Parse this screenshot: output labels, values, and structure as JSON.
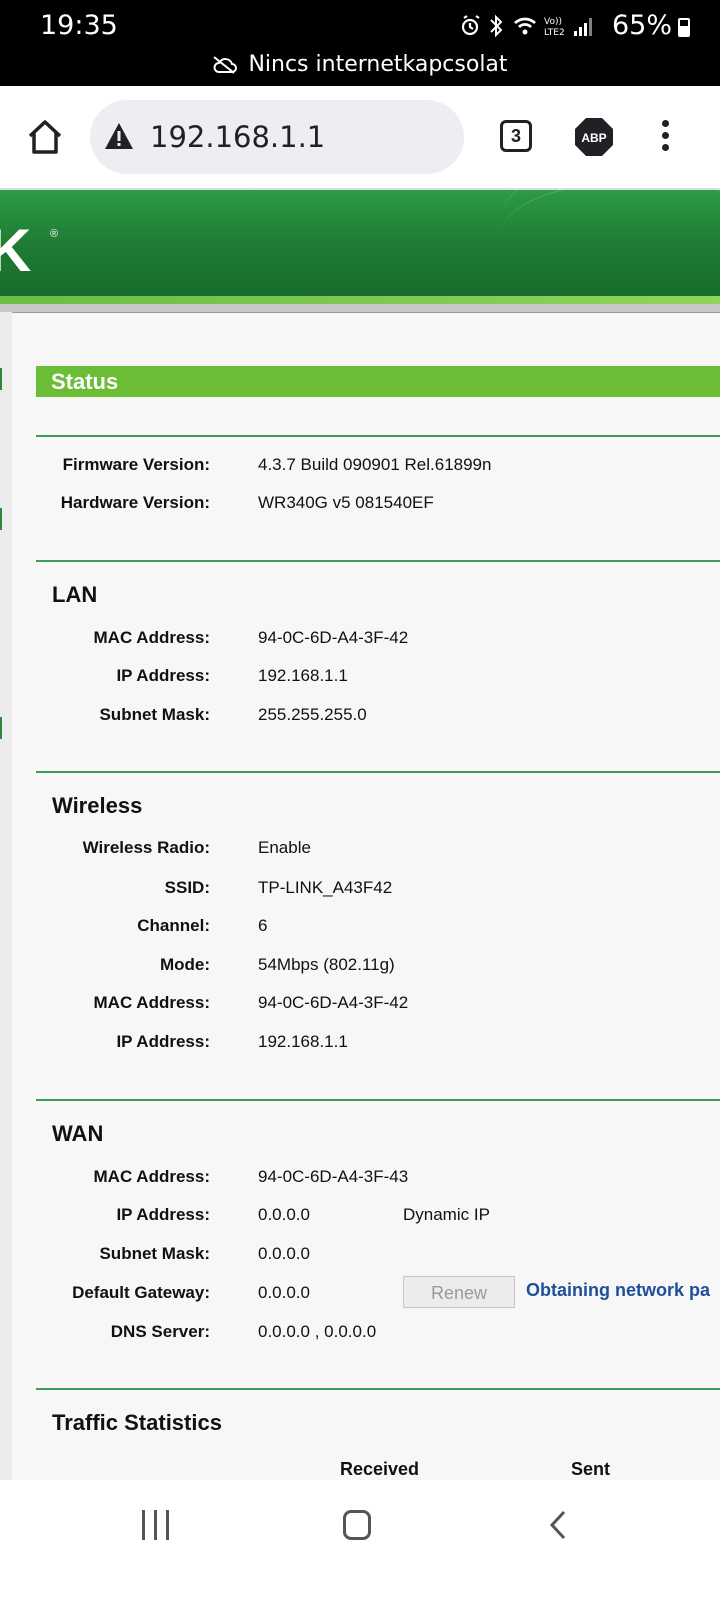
{
  "status_bar": {
    "time": "19:35",
    "battery": "65%",
    "connection_notice": "Nincs internetkapcsolat"
  },
  "browser": {
    "url": "192.168.1.1",
    "tab_count": "3",
    "adblock_label": "ABP"
  },
  "page": {
    "brand_fragment": "K",
    "status_heading": "Status",
    "general": {
      "firmware_label": "Firmware Version:",
      "firmware_value": "4.3.7 Build 090901 Rel.61899n",
      "hardware_label": "Hardware Version:",
      "hardware_value": "WR340G v5 081540EF"
    },
    "lan": {
      "title": "LAN",
      "mac_label": "MAC Address:",
      "mac_value": "94-0C-6D-A4-3F-42",
      "ip_label": "IP Address:",
      "ip_value": "192.168.1.1",
      "mask_label": "Subnet Mask:",
      "mask_value": "255.255.255.0"
    },
    "wireless": {
      "title": "Wireless",
      "radio_label": "Wireless Radio:",
      "radio_value": "Enable",
      "ssid_label": "SSID:",
      "ssid_value": "TP-LINK_A43F42",
      "channel_label": "Channel:",
      "channel_value": "6",
      "mode_label": "Mode:",
      "mode_value": "54Mbps (802.11g)",
      "mac_label": "MAC Address:",
      "mac_value": "94-0C-6D-A4-3F-42",
      "ip_label": "IP Address:",
      "ip_value": "192.168.1.1"
    },
    "wan": {
      "title": "WAN",
      "mac_label": "MAC Address:",
      "mac_value": "94-0C-6D-A4-3F-43",
      "ip_label": "IP Address:",
      "ip_value": "0.0.0.0",
      "ip_type": "Dynamic IP",
      "mask_label": "Subnet Mask:",
      "mask_value": "0.0.0.0",
      "gateway_label": "Default Gateway:",
      "gateway_value": "0.0.0.0",
      "renew_label": "Renew",
      "obtaining_text": "Obtaining network pa",
      "dns_label": "DNS Server:",
      "dns_value": "0.0.0.0 , 0.0.0.0"
    },
    "traffic": {
      "title": "Traffic Statistics",
      "received_label": "Received",
      "sent_label": "Sent"
    }
  },
  "colors": {
    "status_green": "#6abd35",
    "divider_green": "#3e9a5e",
    "banner_green": "#1f7d34",
    "link_blue": "#1f4e9b"
  }
}
